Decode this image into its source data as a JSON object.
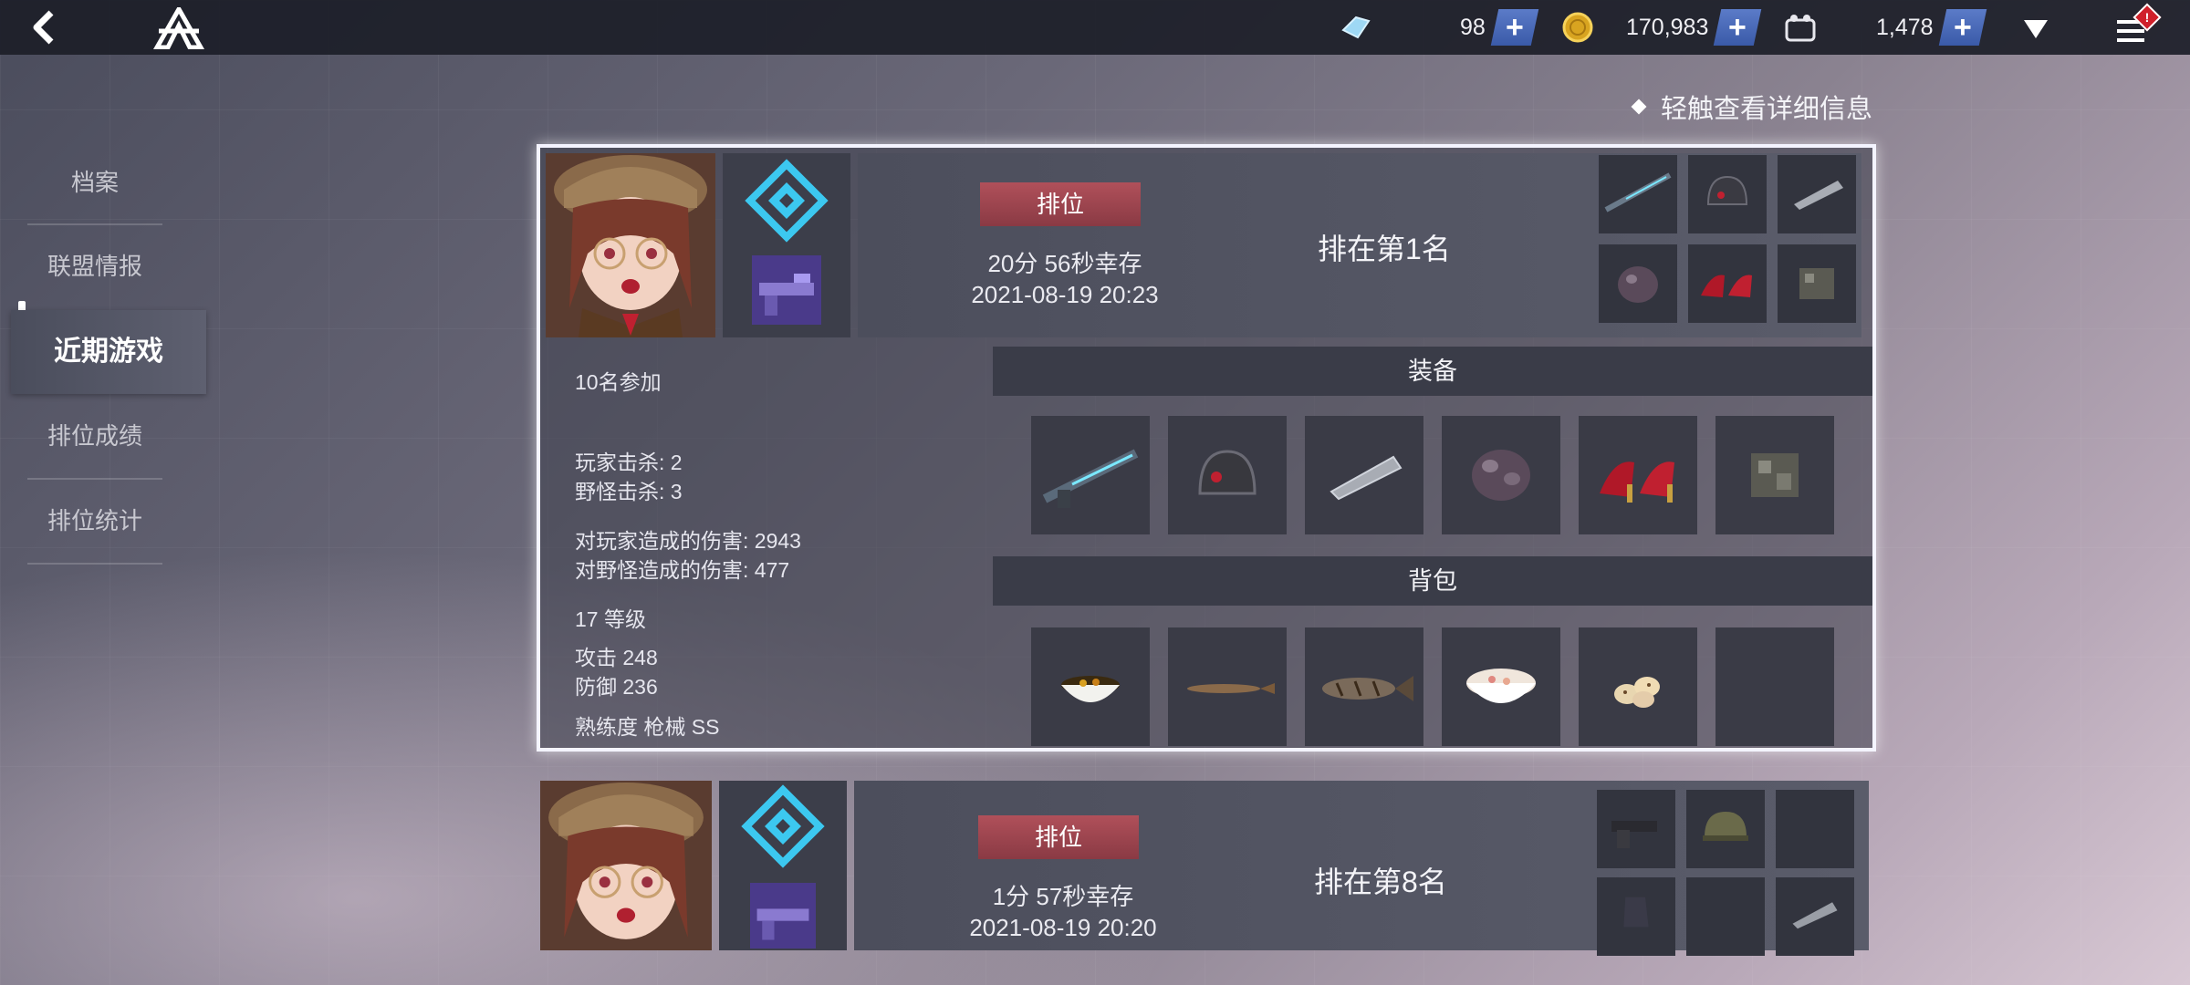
{
  "topbar": {
    "gems": "98",
    "gold": "170,983",
    "tickets": "1,478",
    "menu_badge": "!"
  },
  "sidenav": {
    "items": [
      "档案",
      "联盟情报",
      "近期游戏",
      "排位成绩",
      "排位统计"
    ],
    "active_index": 2
  },
  "hint": "轻触查看详细信息",
  "matches": [
    {
      "mode": "排位",
      "survival": "20分 56秒幸存",
      "datetime": "2021-08-19 20:23",
      "rank_text": "排在第1名",
      "participants": "10名参加",
      "player_kills": "玩家击杀: 2",
      "monster_kills": "野怪击杀: 3",
      "damage_players": "对玩家造成的伤害: 2943",
      "damage_monsters": "对野怪造成的伤害: 477",
      "level": "17 等级",
      "attack": "攻击 248",
      "defense": "防御 236",
      "mastery": "熟练度 枪械 SS",
      "equipment_title": "装备",
      "backpack_title": "背包",
      "equipment_icons": [
        "rifle-icon",
        "helmet-icon",
        "arm-guard-icon",
        "armor-icon",
        "high-heels-icon",
        "accessory-icon"
      ],
      "backpack_icons": [
        "bowl-food-icon",
        "grilled-fish-small-icon",
        "grilled-fish-icon",
        "rice-bowl-icon",
        "eggs-icon",
        ""
      ]
    },
    {
      "mode": "排位",
      "survival": "1分 57秒幸存",
      "datetime": "2021-08-19 20:20",
      "rank_text": "排在第8名",
      "equipment_icons": [
        "pistol-icon",
        "helmet-icon",
        "",
        "glove-icon",
        "",
        "arm-guard-icon"
      ]
    }
  ],
  "colors": {
    "accent_blue": "#3cc8f0",
    "mode_tag": "#a04650",
    "plus_button": "#4a6ab8"
  }
}
